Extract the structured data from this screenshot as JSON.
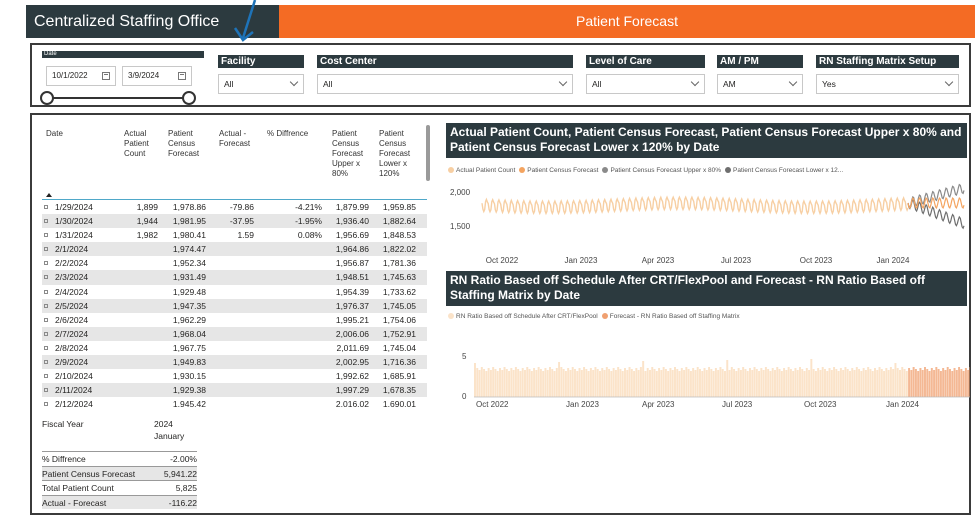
{
  "header": {
    "left_title": "Centralized Staffing Office",
    "right_title": "Patient Forecast"
  },
  "filters": {
    "date": {
      "title": "Date",
      "start": "10/1/2022",
      "end": "3/9/2024"
    },
    "slicers": [
      {
        "title": "Facility",
        "value": "All"
      },
      {
        "title": "Cost Center",
        "value": "All"
      },
      {
        "title": "Level of Care",
        "value": "All"
      },
      {
        "title": "AM / PM",
        "value": "AM"
      },
      {
        "title": "RN Staffing Matrix Setup",
        "value": "Yes"
      }
    ]
  },
  "table": {
    "columns": [
      {
        "label": "Date"
      },
      {
        "label": "Actual\nPatient\nCount"
      },
      {
        "label": "Patient\nCensus\nForecast"
      },
      {
        "label": "Actual -\nForecast"
      },
      {
        "label": "% Diffrence"
      },
      {
        "label": "Patient\nCensus\nForecast\nUpper x\n80%"
      },
      {
        "label": "Patient\nCensus\nForecast\nLower x\n120%"
      }
    ],
    "rows": [
      [
        "1/29/2024",
        "1,899",
        "1,978.86",
        "-79.86",
        "-4.21%",
        "1,879.99",
        "1,959.85"
      ],
      [
        "1/30/2024",
        "1,944",
        "1,981.95",
        "-37.95",
        "-1.95%",
        "1,936.40",
        "1,882.64"
      ],
      [
        "1/31/2024",
        "1,982",
        "1,980.41",
        "1.59",
        "0.08%",
        "1,956.69",
        "1,848.53"
      ],
      [
        "2/1/2024",
        "",
        "1,974.47",
        "",
        "",
        "1,964.86",
        "1,822.02"
      ],
      [
        "2/2/2024",
        "",
        "1,952.34",
        "",
        "",
        "1,956.87",
        "1,781.36"
      ],
      [
        "2/3/2024",
        "",
        "1,931.49",
        "",
        "",
        "1,948.51",
        "1,745.63"
      ],
      [
        "2/4/2024",
        "",
        "1,929.48",
        "",
        "",
        "1,954.39",
        "1,733.62"
      ],
      [
        "2/5/2024",
        "",
        "1,947.35",
        "",
        "",
        "1,976.37",
        "1,745.05"
      ],
      [
        "2/6/2024",
        "",
        "1,962.29",
        "",
        "",
        "1,995.21",
        "1,754.06"
      ],
      [
        "2/7/2024",
        "",
        "1,968.04",
        "",
        "",
        "2,006.06",
        "1,752.91"
      ],
      [
        "2/8/2024",
        "",
        "1,967.75",
        "",
        "",
        "2,011.69",
        "1,745.04"
      ],
      [
        "2/9/2024",
        "",
        "1,949.83",
        "",
        "",
        "2,002.95",
        "1,716.36"
      ],
      [
        "2/10/2024",
        "",
        "1,930.15",
        "",
        "",
        "1,992.62",
        "1,685.91"
      ],
      [
        "2/11/2024",
        "",
        "1,929.38",
        "",
        "",
        "1,997.29",
        "1,678.35"
      ],
      [
        "2/12/2024",
        "",
        "1,945.42",
        "",
        "",
        "2,016.02",
        "1,690.01"
      ]
    ]
  },
  "fiscal_table": {
    "header_label": "Fiscal Year",
    "header_year": "2024",
    "header_month": "January",
    "rows": [
      {
        "label": "% Diffrence",
        "value": "-2.00%"
      },
      {
        "label": "Patient Census Forecast",
        "value": "5,941.22"
      },
      {
        "label": "Total Patient Count",
        "value": "5,825"
      },
      {
        "label": "Actual - Forecast",
        "value": "-116.22"
      }
    ]
  },
  "chart_data": [
    {
      "type": "line",
      "title": "Actual Patient Count, Patient Census Forecast, Patient Census Forecast Upper x 80% and Patient Census Forecast Lower x 120% by Date",
      "legend": [
        {
          "name": "Actual Patient Count",
          "color": "#f7cfa3"
        },
        {
          "name": "Patient Census Forecast",
          "color": "#f4a460"
        },
        {
          "name": "Patient Census Forecast Upper x 80%",
          "color": "#8a8a8a"
        },
        {
          "name": "Patient Census Forecast Lower x 12...",
          "color": "#6e6e6e"
        }
      ],
      "x_ticks": [
        "Oct 2022",
        "Jan 2023",
        "Apr 2023",
        "Jul 2023",
        "Oct 2023",
        "Jan 2024"
      ],
      "y_ticks": [
        "2,000",
        "1,500"
      ],
      "ylim": [
        1500,
        2000
      ]
    },
    {
      "type": "bar",
      "title": "RN Ratio Based off Schedule After CRT/FlexPool and Forecast - RN Ratio Based off Staffing Matrix by Date",
      "legend": [
        {
          "name": "RN Ratio Based off Schedule After CRT/FlexPool",
          "color": "#fbe3c9"
        },
        {
          "name": "Forecast - RN Ratio Based off Staffing Matrix",
          "color": "#f0a070"
        }
      ],
      "x_ticks": [
        "Oct 2022",
        "Jan 2023",
        "Apr 2023",
        "Jul 2023",
        "Oct 2023",
        "Jan 2024"
      ],
      "y_ticks": [
        "5",
        "0"
      ],
      "ylim": [
        0,
        7
      ]
    }
  ]
}
